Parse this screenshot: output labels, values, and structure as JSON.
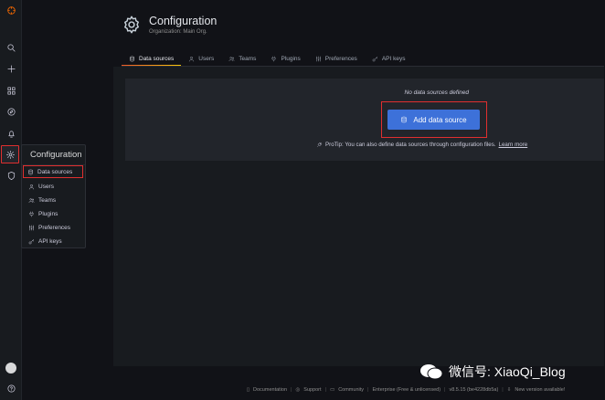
{
  "sidebar": {
    "icons": [
      "grafana-logo-icon",
      "search-icon",
      "plus-icon",
      "dashboards-icon",
      "explore-icon",
      "bell-icon",
      "gear-icon",
      "shield-icon",
      "avatar",
      "help-icon"
    ]
  },
  "flyout": {
    "title": "Configuration",
    "items": [
      {
        "label": "Data sources",
        "icon": "database-icon"
      },
      {
        "label": "Users",
        "icon": "user-icon"
      },
      {
        "label": "Teams",
        "icon": "users-icon"
      },
      {
        "label": "Plugins",
        "icon": "plug-icon"
      },
      {
        "label": "Preferences",
        "icon": "sliders-icon"
      },
      {
        "label": "API keys",
        "icon": "key-icon"
      }
    ]
  },
  "header": {
    "title": "Configuration",
    "subtitle": "Organization: Main Org."
  },
  "tabs": [
    {
      "label": "Data sources",
      "active": true
    },
    {
      "label": "Users"
    },
    {
      "label": "Teams"
    },
    {
      "label": "Plugins"
    },
    {
      "label": "Preferences"
    },
    {
      "label": "API keys"
    }
  ],
  "main": {
    "empty_text": "No data sources defined",
    "add_button": "Add data source",
    "protip": "ProTip: You can also define data sources through configuration files.",
    "protip_link": "Learn more"
  },
  "footer": {
    "documentation": "Documentation",
    "support": "Support",
    "community": "Community",
    "edition": "Enterprise (Free & unlicensed)",
    "version": "v8.5.15 (be4228db5a)",
    "new_version": "New version available!"
  },
  "watermark": {
    "text": "微信号: XiaoQi_Blog"
  },
  "colors": {
    "accent_blue": "#3d71d9",
    "highlight_red": "#e02f2f",
    "bg": "#111217",
    "panel": "#181b1f"
  }
}
